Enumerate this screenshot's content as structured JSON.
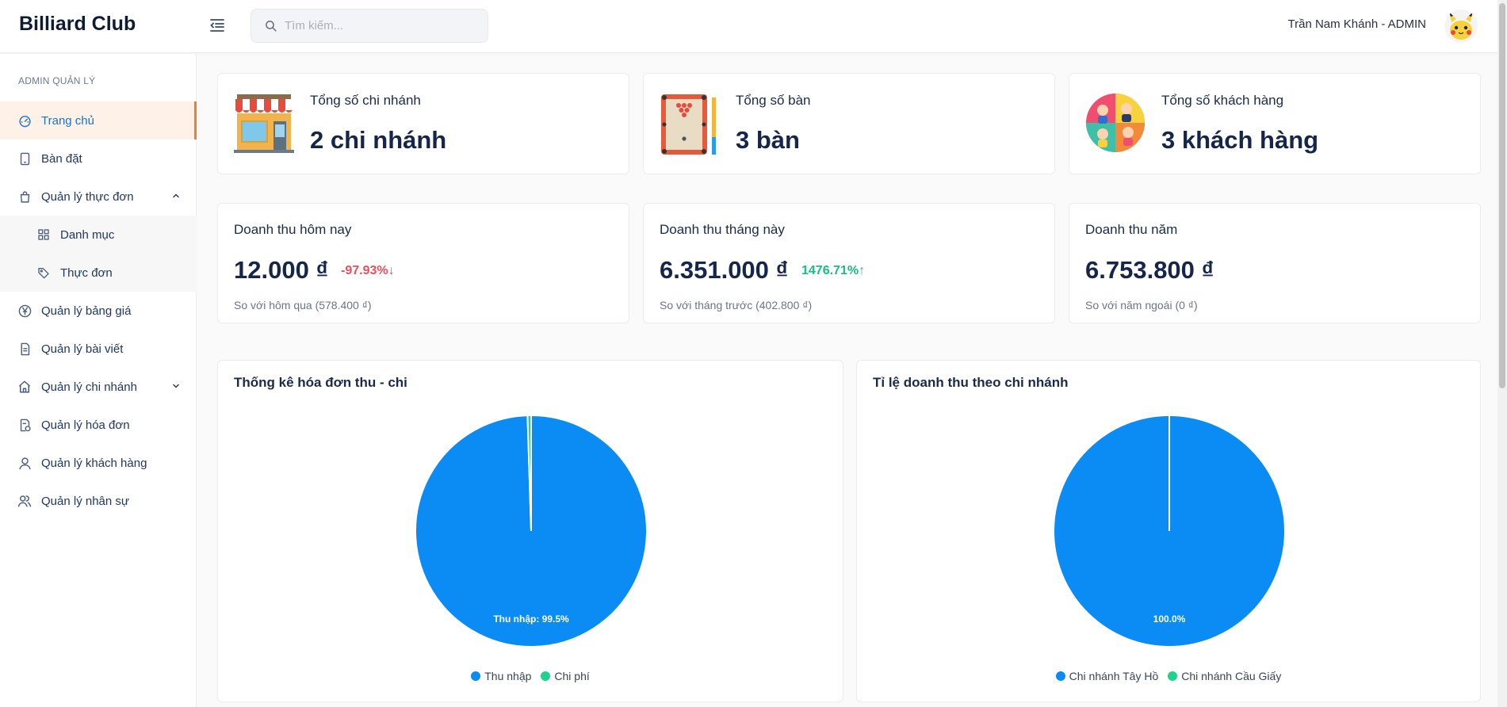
{
  "header": {
    "brand": "Billiard Club",
    "search_placeholder": "Tìm kiếm...",
    "user": "Trần Nam Khánh - ADMIN"
  },
  "sidebar": {
    "section": "ADMIN QUẢN LÝ",
    "items": [
      {
        "label": "Trang chủ",
        "icon": "dashboard-icon",
        "active": true
      },
      {
        "label": "Bàn đặt",
        "icon": "tablet-icon"
      },
      {
        "label": "Quản lý thực đơn",
        "icon": "shopping-bag-icon",
        "expanded": true,
        "children": [
          {
            "label": "Danh mục",
            "icon": "grid-icon"
          },
          {
            "label": "Thực đơn",
            "icon": "tag-icon"
          }
        ]
      },
      {
        "label": "Quản lý bảng giá",
        "icon": "yen-circle-icon"
      },
      {
        "label": "Quản lý bài viết",
        "icon": "document-icon"
      },
      {
        "label": "Quản lý chi nhánh",
        "icon": "home-icon",
        "expanded": false
      },
      {
        "label": "Quản lý hóa đơn",
        "icon": "invoice-icon"
      },
      {
        "label": "Quản lý khách hàng",
        "icon": "user-icon"
      },
      {
        "label": "Quản lý nhân sự",
        "icon": "team-icon"
      }
    ]
  },
  "stats": [
    {
      "label": "Tổng số chi nhánh",
      "value": "2 chi nhánh",
      "icon": "storefront-icon"
    },
    {
      "label": "Tổng số bàn",
      "value": "3 bàn",
      "icon": "billiard-table-icon"
    },
    {
      "label": "Tổng số khách hàng",
      "value": "3 khách hàng",
      "icon": "customers-icon"
    }
  ],
  "revenue": [
    {
      "label": "Doanh thu hôm nay",
      "value": "12.000 ₫",
      "delta": "-97.93%",
      "direction": "down",
      "compare": "So với hôm qua (578.400 ₫)"
    },
    {
      "label": "Doanh thu tháng này",
      "value": "6.351.000 ₫",
      "delta": "1476.71%",
      "direction": "up",
      "compare": "So với tháng trước (402.800 ₫)"
    },
    {
      "label": "Doanh thu năm",
      "value": "6.753.800 ₫",
      "compare": "So với năm ngoái (0 ₫)"
    }
  ],
  "colors": {
    "accent": "#1a73d1",
    "active_bar": "#f07e2e",
    "pie_blue": "#0b8cf5",
    "pie_green": "#1fd38e",
    "down": "#ec4e5a",
    "up": "#19be7c"
  },
  "chart_data": [
    {
      "type": "pie",
      "title": "Thống kê hóa đơn thu - chi",
      "categories": [
        "Thu nhập",
        "Chi phí"
      ],
      "values": [
        99.5,
        0.5
      ],
      "labels": [
        "Thu nhập: 99.5%"
      ],
      "legend": "bottom"
    },
    {
      "type": "pie",
      "title": "Tỉ lệ doanh thu theo chi nhánh",
      "categories": [
        "Chi nhánh Tây Hồ",
        "Chi nhánh Cầu Giấy"
      ],
      "values": [
        100.0,
        0.0
      ],
      "labels": [
        "100.0%"
      ],
      "legend": "bottom"
    }
  ]
}
